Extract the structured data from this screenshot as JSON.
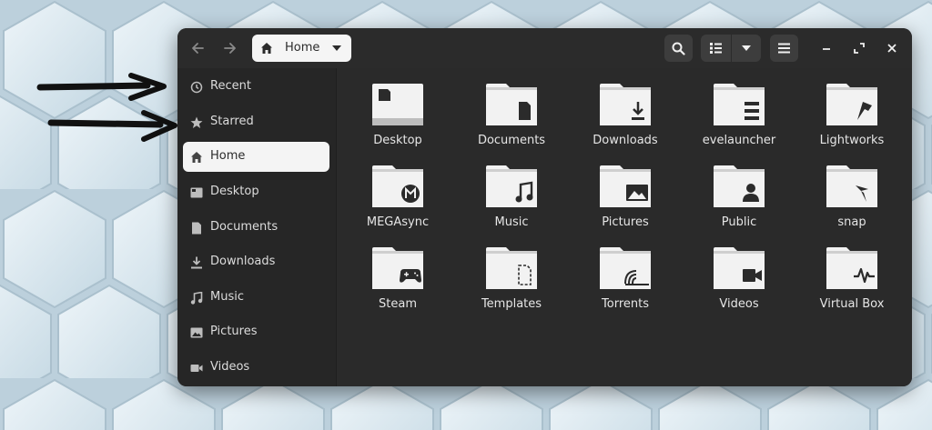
{
  "window": {
    "path_label": "Home",
    "back_icon": "arrow-left-icon",
    "forward_icon": "arrow-right-icon"
  },
  "sidebar": {
    "items": [
      {
        "label": "Recent",
        "icon": "clock-icon",
        "active": false
      },
      {
        "label": "Starred",
        "icon": "star-icon",
        "active": false
      },
      {
        "label": "Home",
        "icon": "home-icon",
        "active": true
      },
      {
        "label": "Desktop",
        "icon": "desktop-icon",
        "active": false
      },
      {
        "label": "Documents",
        "icon": "document-icon",
        "active": false
      },
      {
        "label": "Downloads",
        "icon": "download-icon",
        "active": false
      },
      {
        "label": "Music",
        "icon": "music-icon",
        "active": false
      },
      {
        "label": "Pictures",
        "icon": "picture-icon",
        "active": false
      },
      {
        "label": "Videos",
        "icon": "video-icon",
        "active": false
      }
    ]
  },
  "files": [
    {
      "label": "Desktop",
      "icon": "desktop-folder-icon"
    },
    {
      "label": "Documents",
      "icon": "documents-folder-icon"
    },
    {
      "label": "Downloads",
      "icon": "downloads-folder-icon"
    },
    {
      "label": "evelauncher",
      "icon": "folder-icon"
    },
    {
      "label": "Lightworks",
      "icon": "lightworks-folder-icon"
    },
    {
      "label": "MEGAsync",
      "icon": "megasync-folder-icon"
    },
    {
      "label": "Music",
      "icon": "music-folder-icon"
    },
    {
      "label": "Pictures",
      "icon": "pictures-folder-icon"
    },
    {
      "label": "Public",
      "icon": "public-folder-icon"
    },
    {
      "label": "snap",
      "icon": "snap-folder-icon"
    },
    {
      "label": "Steam",
      "icon": "steam-folder-icon"
    },
    {
      "label": "Templates",
      "icon": "templates-folder-icon"
    },
    {
      "label": "Torrents",
      "icon": "torrents-folder-icon"
    },
    {
      "label": "Videos",
      "icon": "videos-folder-icon"
    },
    {
      "label": "Virtual Box",
      "icon": "virtualbox-folder-icon"
    }
  ],
  "colors": {
    "window_bg": "#2b2b2b",
    "sidebar_bg": "#262626",
    "active_item_bg": "#f4f4f4",
    "folder": "#f2f2f2",
    "wallpaper": "#d6e6ee"
  }
}
